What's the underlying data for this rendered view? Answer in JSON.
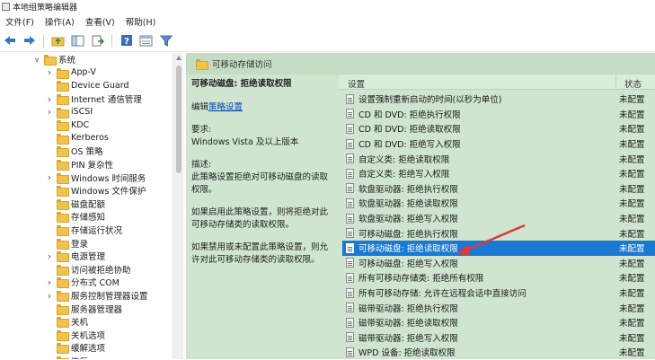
{
  "window": {
    "title": "本地组策略编辑器"
  },
  "menu": [
    "文件(F)",
    "操作(A)",
    "查看(V)",
    "帮助(H)"
  ],
  "toolbar": {
    "icons": [
      "back-icon",
      "forward-icon",
      "up-folder-icon",
      "show-tree-icon",
      "export-icon",
      "help-icon",
      "properties-icon",
      "filter-icon"
    ]
  },
  "tree": {
    "items": [
      {
        "label": "系统",
        "expanded": true,
        "has_children": true
      },
      {
        "label": "App-V",
        "has_children": true
      },
      {
        "label": "Device Guard",
        "has_children": false
      },
      {
        "label": "Internet 通信管理",
        "has_children": true
      },
      {
        "label": "iSCSI",
        "has_children": true
      },
      {
        "label": "KDC",
        "has_children": false
      },
      {
        "label": "Kerberos",
        "has_children": false
      },
      {
        "label": "OS 策略",
        "has_children": false
      },
      {
        "label": "PIN 复杂性",
        "has_children": false
      },
      {
        "label": "Windows 时间服务",
        "has_children": true
      },
      {
        "label": "Windows 文件保护",
        "has_children": false
      },
      {
        "label": "磁盘配额",
        "has_children": false
      },
      {
        "label": "存储感知",
        "has_children": false
      },
      {
        "label": "存储运行状况",
        "has_children": false
      },
      {
        "label": "登录",
        "has_children": false
      },
      {
        "label": "电源管理",
        "has_children": true
      },
      {
        "label": "访问被拒绝协助",
        "has_children": false
      },
      {
        "label": "分布式 COM",
        "has_children": true
      },
      {
        "label": "服务控制管理器设置",
        "has_children": true
      },
      {
        "label": "服务器管理器",
        "has_children": false
      },
      {
        "label": "关机",
        "has_children": false
      },
      {
        "label": "关机选项",
        "has_children": false
      },
      {
        "label": "缓解选项",
        "has_children": false
      },
      {
        "label": "恢复",
        "has_children": false
      }
    ]
  },
  "main": {
    "header_title": "可移动存储访问",
    "desc": {
      "policy_title": "可移动磁盘: 拒绝读取权限",
      "edit_prefix": "编辑",
      "edit_link": "策略设置",
      "requirement_label": "要求:",
      "requirement_value": "Windows Vista 及以上版本",
      "description_label": "描述:",
      "description_text": "此策略设置拒绝对可移动磁盘的读取权限。",
      "enabled_text": "如果启用此策略设置，则将拒绝对此可移动存储类的读取权限。",
      "disabled_text": "如果禁用或未配置此策略设置，则允许对此可移动存储类的读取权限。"
    },
    "columns": {
      "setting": "设置",
      "state": "状态"
    },
    "rows": [
      {
        "name": "设置强制重新启动的时间(以秒为单位)",
        "state": "未配置"
      },
      {
        "name": "CD 和 DVD: 拒绝执行权限",
        "state": "未配置"
      },
      {
        "name": "CD 和 DVD: 拒绝读取权限",
        "state": "未配置"
      },
      {
        "name": "CD 和 DVD: 拒绝写入权限",
        "state": "未配置"
      },
      {
        "name": "自定义类: 拒绝读取权限",
        "state": "未配置"
      },
      {
        "name": "自定义类: 拒绝写入权限",
        "state": "未配置"
      },
      {
        "name": "软盘驱动器: 拒绝执行权限",
        "state": "未配置"
      },
      {
        "name": "软盘驱动器: 拒绝读取权限",
        "state": "未配置"
      },
      {
        "name": "软盘驱动器: 拒绝写入权限",
        "state": "未配置"
      },
      {
        "name": "可移动磁盘: 拒绝执行权限",
        "state": "未配置"
      },
      {
        "name": "可移动磁盘: 拒绝读取权限",
        "state": "未配置",
        "selected": true
      },
      {
        "name": "可移动磁盘: 拒绝写入权限",
        "state": "未配置"
      },
      {
        "name": "所有可移动存储类: 拒绝所有权限",
        "state": "未配置"
      },
      {
        "name": "所有可移动存储: 允许在远程会话中直接访问",
        "state": "未配置"
      },
      {
        "name": "磁带驱动器: 拒绝执行权限",
        "state": "未配置"
      },
      {
        "name": "磁带驱动器: 拒绝读取权限",
        "state": "未配置"
      },
      {
        "name": "磁带驱动器: 拒绝写入权限",
        "state": "未配置"
      },
      {
        "name": "WPD 设备: 拒绝读取权限",
        "state": "未配置"
      }
    ]
  },
  "colors": {
    "accent": "#1979d3",
    "pane_bg": "#cfe5cf",
    "annotation_arrow": "#e0393a"
  }
}
